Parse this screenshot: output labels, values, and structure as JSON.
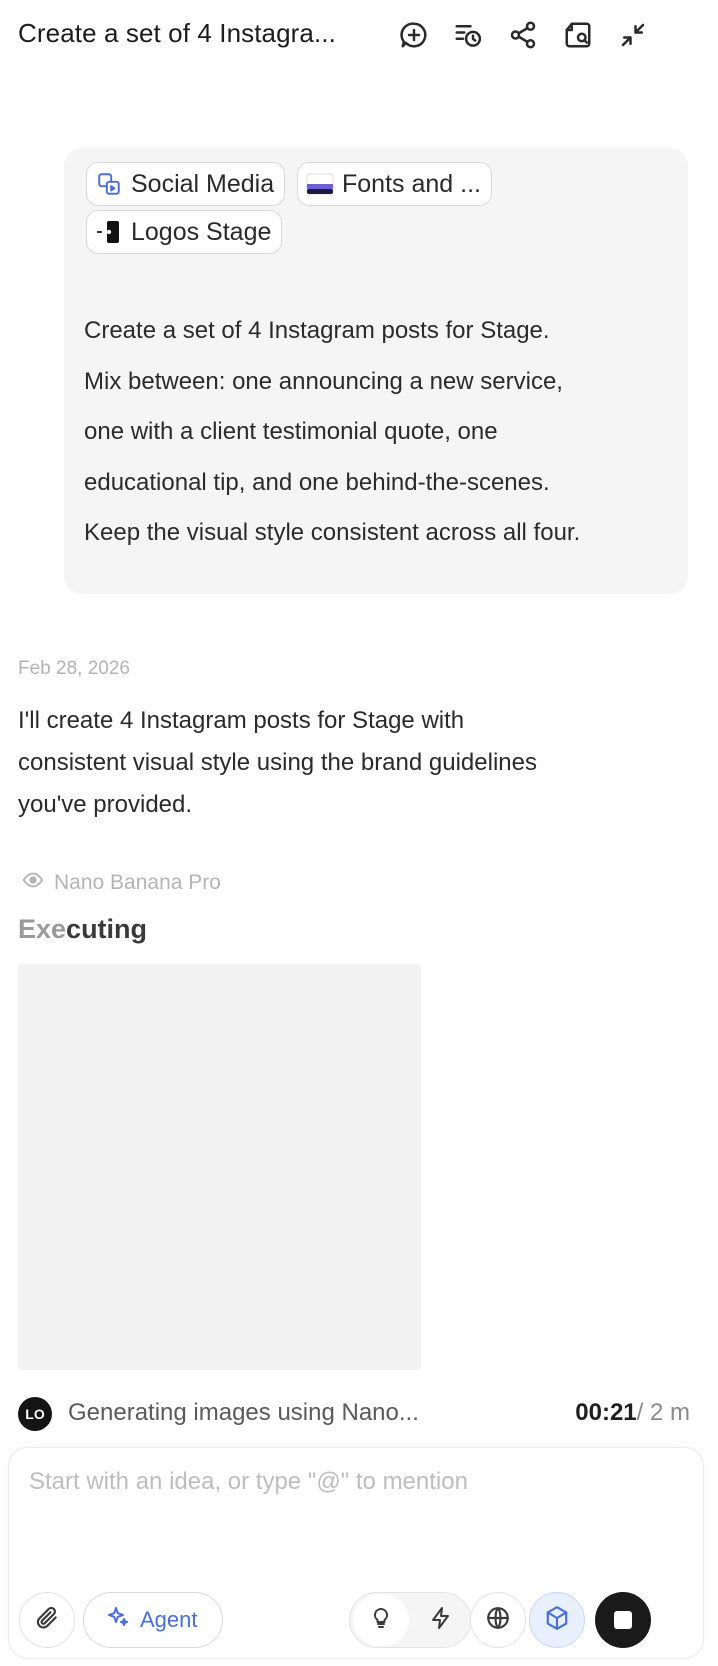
{
  "header": {
    "title": "Create a set of 4 Instagra...",
    "icons": [
      "new-chat-icon",
      "history-icon",
      "share-icon",
      "edit-note-icon",
      "minimize-icon"
    ]
  },
  "user_message": {
    "chips": [
      {
        "label": "Social Media",
        "icon": "social-media-icon"
      },
      {
        "label": "Fonts and ...",
        "icon": "fonts-thumbnail-icon"
      },
      {
        "label": "Logos Stage",
        "icon": "logo-thumbnail-icon"
      }
    ],
    "lines": [
      "Create a set of 4 Instagram posts for Stage.",
      "Mix between: one announcing a new service,",
      "one with a client testimonial quote, one",
      "educational tip, and one behind-the-scenes.",
      "Keep the visual style consistent across all four."
    ]
  },
  "assistant": {
    "date": "Feb 28, 2026",
    "reply_lines": [
      "I'll create 4 Instagram posts for Stage with",
      "consistent visual style using the brand guidelines",
      "you've provided."
    ],
    "model_name": "Nano Banana Pro",
    "status_dim": "Exe",
    "status_rest": "cuting",
    "generation": {
      "avatar_text": "LO",
      "text": "Generating images using Nano...",
      "elapsed": "00:21",
      "estimate": "/ 2 m"
    }
  },
  "composer": {
    "placeholder": "Start with an idea, or type \"@\" to mention",
    "agent_label": "Agent",
    "accent_color": "#4a6fd6"
  }
}
